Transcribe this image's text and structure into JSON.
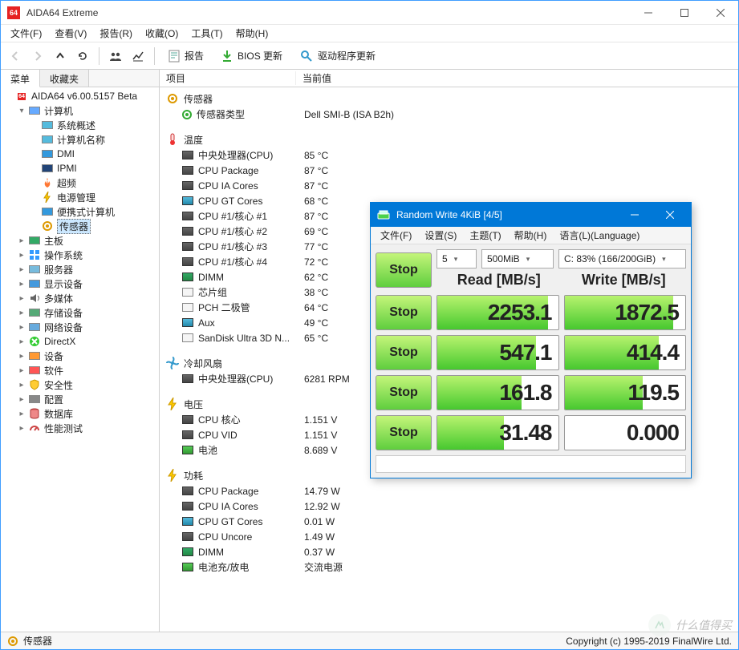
{
  "window": {
    "title": "AIDA64 Extreme",
    "min_tip": "Minimize",
    "max_tip": "Maximize",
    "close_tip": "Close"
  },
  "menu": {
    "file": "文件(F)",
    "view": "查看(V)",
    "report": "报告(R)",
    "favorites": "收藏(O)",
    "tools": "工具(T)",
    "help": "帮助(H)"
  },
  "toolbar": {
    "report": "报告",
    "bios": "BIOS 更新",
    "driver": "驱动程序更新"
  },
  "tabs": {
    "menu": "菜单",
    "fav": "收藏夹"
  },
  "tree": {
    "root": "AIDA64 v6.00.5157 Beta",
    "computer": "计算机",
    "computer_children": [
      "系统概述",
      "计算机名称",
      "DMI",
      "IPMI",
      "超频",
      "电源管理",
      "便携式计算机",
      "传感器"
    ],
    "rest": [
      "主板",
      "操作系统",
      "服务器",
      "显示设备",
      "多媒体",
      "存储设备",
      "网络设备",
      "DirectX",
      "设备",
      "软件",
      "安全性",
      "配置",
      "数据库",
      "性能测试"
    ]
  },
  "columns": {
    "item": "项目",
    "value": "当前值"
  },
  "groups": {
    "sensor": "传感器",
    "sensor_type_label": "传感器类型",
    "sensor_type_value": "Dell SMI-B  (ISA B2h)",
    "temp": "温度",
    "fan": "冷却风扇",
    "volt": "电压",
    "power": "功耗"
  },
  "temp_rows": [
    {
      "l": "中央处理器(CPU)",
      "v": "85 °C"
    },
    {
      "l": "CPU Package",
      "v": "87 °C"
    },
    {
      "l": "CPU IA Cores",
      "v": "87 °C"
    },
    {
      "l": "CPU GT Cores",
      "v": "68 °C"
    },
    {
      "l": "CPU #1/核心 #1",
      "v": "87 °C"
    },
    {
      "l": "CPU #1/核心 #2",
      "v": "69 °C"
    },
    {
      "l": "CPU #1/核心 #3",
      "v": "77 °C"
    },
    {
      "l": "CPU #1/核心 #4",
      "v": "72 °C"
    },
    {
      "l": "DIMM",
      "v": "62 °C"
    },
    {
      "l": "芯片组",
      "v": "38 °C"
    },
    {
      "l": "PCH 二极管",
      "v": "64 °C"
    },
    {
      "l": "Aux",
      "v": "49 °C"
    },
    {
      "l": "SanDisk Ultra 3D N...",
      "v": "65 °C"
    }
  ],
  "fan_rows": [
    {
      "l": "中央处理器(CPU)",
      "v": "6281 RPM"
    }
  ],
  "volt_rows": [
    {
      "l": "CPU 核心",
      "v": "1.151 V"
    },
    {
      "l": "CPU VID",
      "v": "1.151 V"
    },
    {
      "l": "电池",
      "v": "8.689 V"
    }
  ],
  "power_rows": [
    {
      "l": "CPU Package",
      "v": "14.79 W"
    },
    {
      "l": "CPU IA Cores",
      "v": "12.92 W"
    },
    {
      "l": "CPU GT Cores",
      "v": "0.01 W"
    },
    {
      "l": "CPU Uncore",
      "v": "1.49 W"
    },
    {
      "l": "DIMM",
      "v": "0.37 W"
    },
    {
      "l": "电池充/放电",
      "v": "交流电源"
    }
  ],
  "status": {
    "left": "传感器",
    "right": "Copyright (c) 1995-2019 FinalWire Ltd."
  },
  "watermark": "什么值得买",
  "cdm": {
    "title": "Random Write 4KiB [4/5]",
    "menu": {
      "file": "文件(F)",
      "settings": "设置(S)",
      "theme": "主题(T)",
      "help": "帮助(H)",
      "lang": "语言(L)(Language)"
    },
    "loops": "5",
    "size": "500MiB",
    "drive": "C: 83% (166/200GiB)",
    "read_hdr": "Read [MB/s]",
    "write_hdr": "Write [MB/s]",
    "stop": "Stop",
    "rows": [
      {
        "r": "2253.1",
        "rw": 92,
        "w": "1872.5",
        "ww": 90
      },
      {
        "r": "547.1",
        "rw": 82,
        "w": "414.4",
        "ww": 78
      },
      {
        "r": "161.8",
        "rw": 70,
        "w": "119.5",
        "ww": 65
      },
      {
        "r": "31.48",
        "rw": 55,
        "w": "0.000",
        "ww": 0
      }
    ]
  }
}
